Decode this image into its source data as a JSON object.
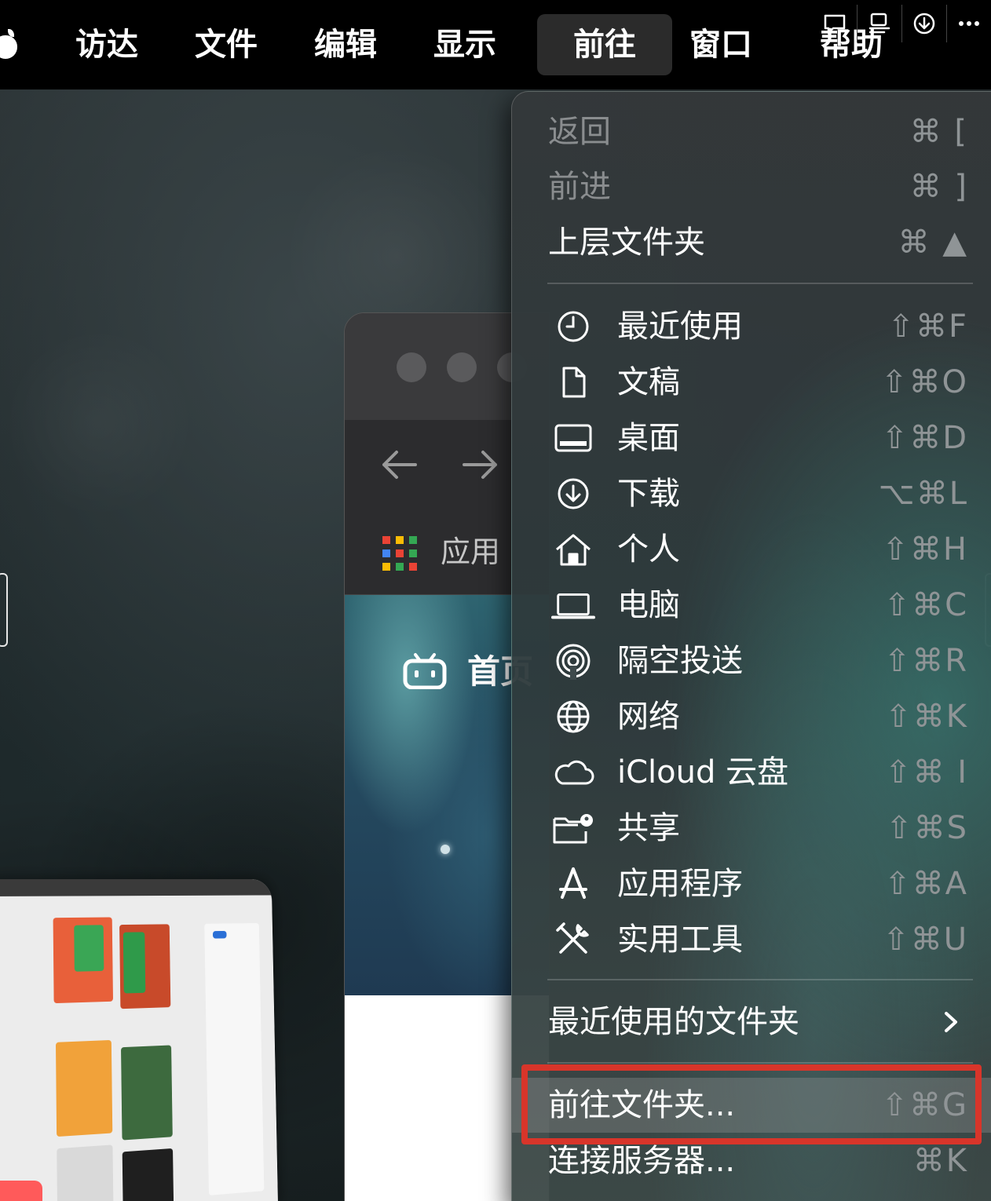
{
  "menubar": {
    "app_name": "访达",
    "menus": [
      "文件",
      "编辑",
      "显示",
      "前往",
      "窗口",
      "帮助"
    ],
    "active_menu": "前往"
  },
  "status_icons": [
    "chat-bubble-icon",
    "display-icon",
    "download-circle-icon",
    "more-icon"
  ],
  "browser": {
    "bookmark_label": "应用",
    "page_title_partial": "首页"
  },
  "go_menu": {
    "items_top": [
      {
        "label": "返回",
        "shortcut": "⌘ [",
        "disabled": true
      },
      {
        "label": "前进",
        "shortcut": "⌘ ]",
        "disabled": true
      },
      {
        "label": "上层文件夹",
        "shortcut": "⌘ ▲",
        "disabled": false
      }
    ],
    "items_places": [
      {
        "label": "最近使用",
        "shortcut": "⇧⌘F",
        "icon": "clock-icon"
      },
      {
        "label": "文稿",
        "shortcut": "⇧⌘O",
        "icon": "document-icon"
      },
      {
        "label": "桌面",
        "shortcut": "⇧⌘D",
        "icon": "desktop-icon"
      },
      {
        "label": "下载",
        "shortcut": "⌥⌘L",
        "icon": "download-icon"
      },
      {
        "label": "个人",
        "shortcut": "⇧⌘H",
        "icon": "home-icon"
      },
      {
        "label": "电脑",
        "shortcut": "⇧⌘C",
        "icon": "laptop-icon"
      },
      {
        "label": "隔空投送",
        "shortcut": "⇧⌘R",
        "icon": "airdrop-icon"
      },
      {
        "label": "网络",
        "shortcut": "⇧⌘K",
        "icon": "globe-icon"
      },
      {
        "label": "iCloud 云盘",
        "shortcut": "⇧⌘ I",
        "icon": "cloud-icon"
      },
      {
        "label": "共享",
        "shortcut": "⇧⌘S",
        "icon": "shared-folder-icon"
      },
      {
        "label": "应用程序",
        "shortcut": "⇧⌘A",
        "icon": "applications-icon"
      },
      {
        "label": "实用工具",
        "shortcut": "⇧⌘U",
        "icon": "utilities-icon"
      }
    ],
    "recent_folders": {
      "label": "最近使用的文件夹"
    },
    "go_to_folder": {
      "label": "前往文件夹...",
      "shortcut": "⇧⌘G"
    },
    "connect_server": {
      "label": "连接服务器...",
      "shortcut": "⌘K"
    }
  },
  "colors": {
    "highlight_border": "#d8352a",
    "menubar_bg": "#000000"
  }
}
